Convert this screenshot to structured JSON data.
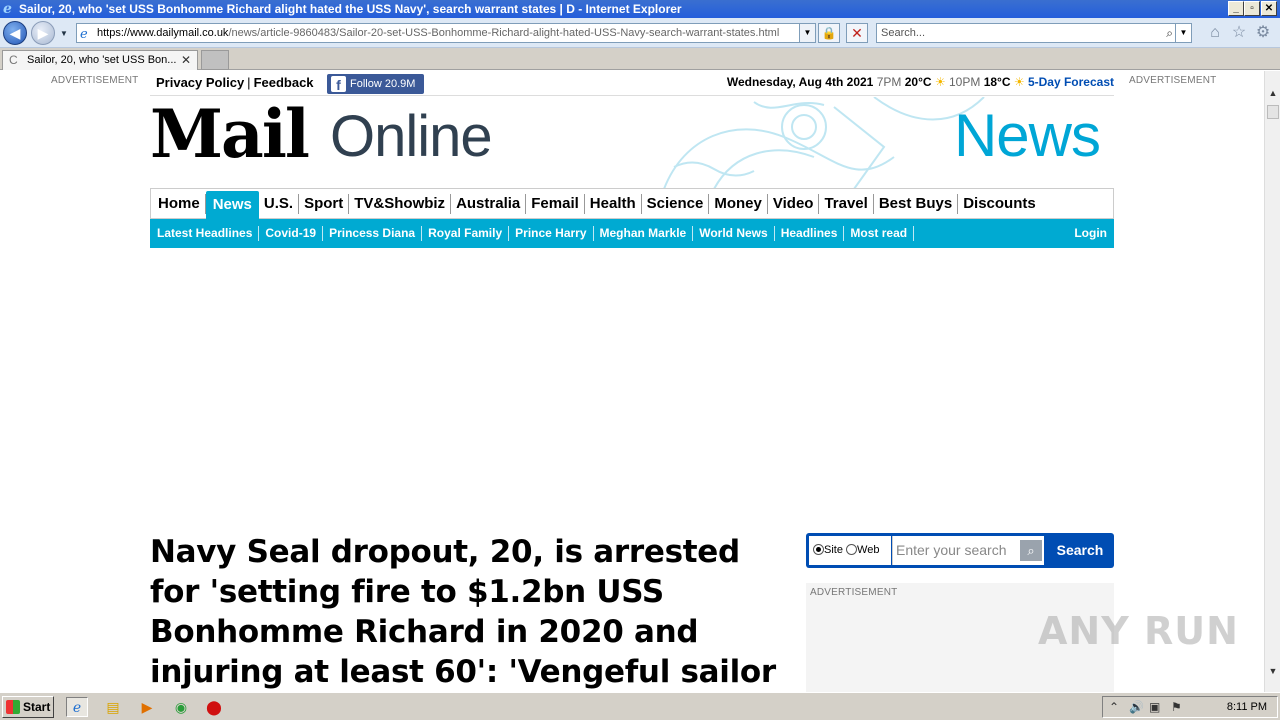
{
  "window": {
    "title": "Sailor, 20, who 'set USS Bonhomme Richard alight hated the USS Navy', search warrant states | D - Internet Explorer"
  },
  "address_bar": {
    "url_host": "https://www.dailymail.co.uk",
    "url_path": "/news/article-9860483/Sailor-20-set-USS-Bonhomme-Richard-alight-hated-USS-Navy-search-warrant-states.html",
    "search_placeholder": "Search..."
  },
  "tab": {
    "label": "Sailor, 20, who 'set USS Bon..."
  },
  "page": {
    "ad_label_left": "ADVERTISEMENT",
    "ad_label_right": "ADVERTISEMENT",
    "top_links": {
      "privacy": "Privacy Policy",
      "separator": "|",
      "feedback": "Feedback"
    },
    "facebook": {
      "glyph": "f",
      "label": "Follow 20.9M"
    },
    "weather": {
      "date": "Wednesday, Aug 4th 2021",
      "time1": "7PM",
      "temp1": "20°C",
      "time2": "10PM",
      "temp2": "18°C",
      "forecast_link": "5-Day Forecast",
      "sun_glyph": "☀"
    },
    "logo": {
      "mail": "Mail",
      "online": "Online"
    },
    "section_title": "News",
    "main_nav": [
      "Home",
      "News",
      "U.S.",
      "Sport",
      "TV&Showbiz",
      "Australia",
      "Femail",
      "Health",
      "Science",
      "Money",
      "Video",
      "Travel",
      "Best Buys",
      "Discounts"
    ],
    "active_nav": "News",
    "sub_nav": [
      "Latest Headlines",
      "Covid-19",
      "Princess Diana",
      "Royal Family",
      "Prince Harry",
      "Meghan Markle",
      "World News",
      "Headlines",
      "Most read"
    ],
    "login": "Login",
    "headline": "Navy Seal dropout, 20, is arrested for 'setting fire to $1.2bn USS Bonhomme Richard in 2020 and injuring at least 60': 'Vengeful sailor hated the Navy",
    "site_search": {
      "radio_site": "Site",
      "radio_web": "Web",
      "placeholder": "Enter your search",
      "button": "Search"
    },
    "sidebar_ad_label": "ADVERTISEMENT",
    "watermark": "ANY RUN"
  },
  "taskbar": {
    "start": "Start",
    "clock": "8:11 PM"
  },
  "colors": {
    "accent": "#00aad2",
    "brand_blue": "#004db3",
    "facebook": "#3b5998"
  }
}
